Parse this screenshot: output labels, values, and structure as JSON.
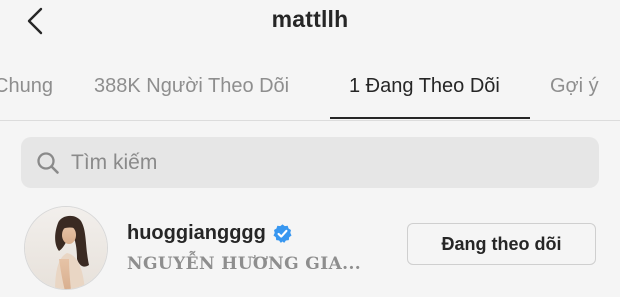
{
  "header": {
    "title": "mattllh",
    "back_icon": "chevron-left-icon"
  },
  "tabs": [
    {
      "label": "Chung",
      "active": false
    },
    {
      "label": "388K Người Theo Dõi",
      "active": false
    },
    {
      "label": "1 Đang Theo Dõi",
      "active": true
    },
    {
      "label": "Gợi ý",
      "active": false
    }
  ],
  "search": {
    "placeholder": "Tìm kiếm",
    "value": "",
    "icon": "search-icon"
  },
  "list": [
    {
      "username": "huoggiangggg",
      "verified": true,
      "full_name": "NGUYỄN HƯƠNG GIA...",
      "button_label": "Đang theo dõi"
    }
  ],
  "colors": {
    "background": "#f5f5f5",
    "text_primary": "#262626",
    "text_secondary": "#8e8e8e",
    "verified_blue": "#3897f0",
    "search_bg": "#e6e6e6"
  }
}
